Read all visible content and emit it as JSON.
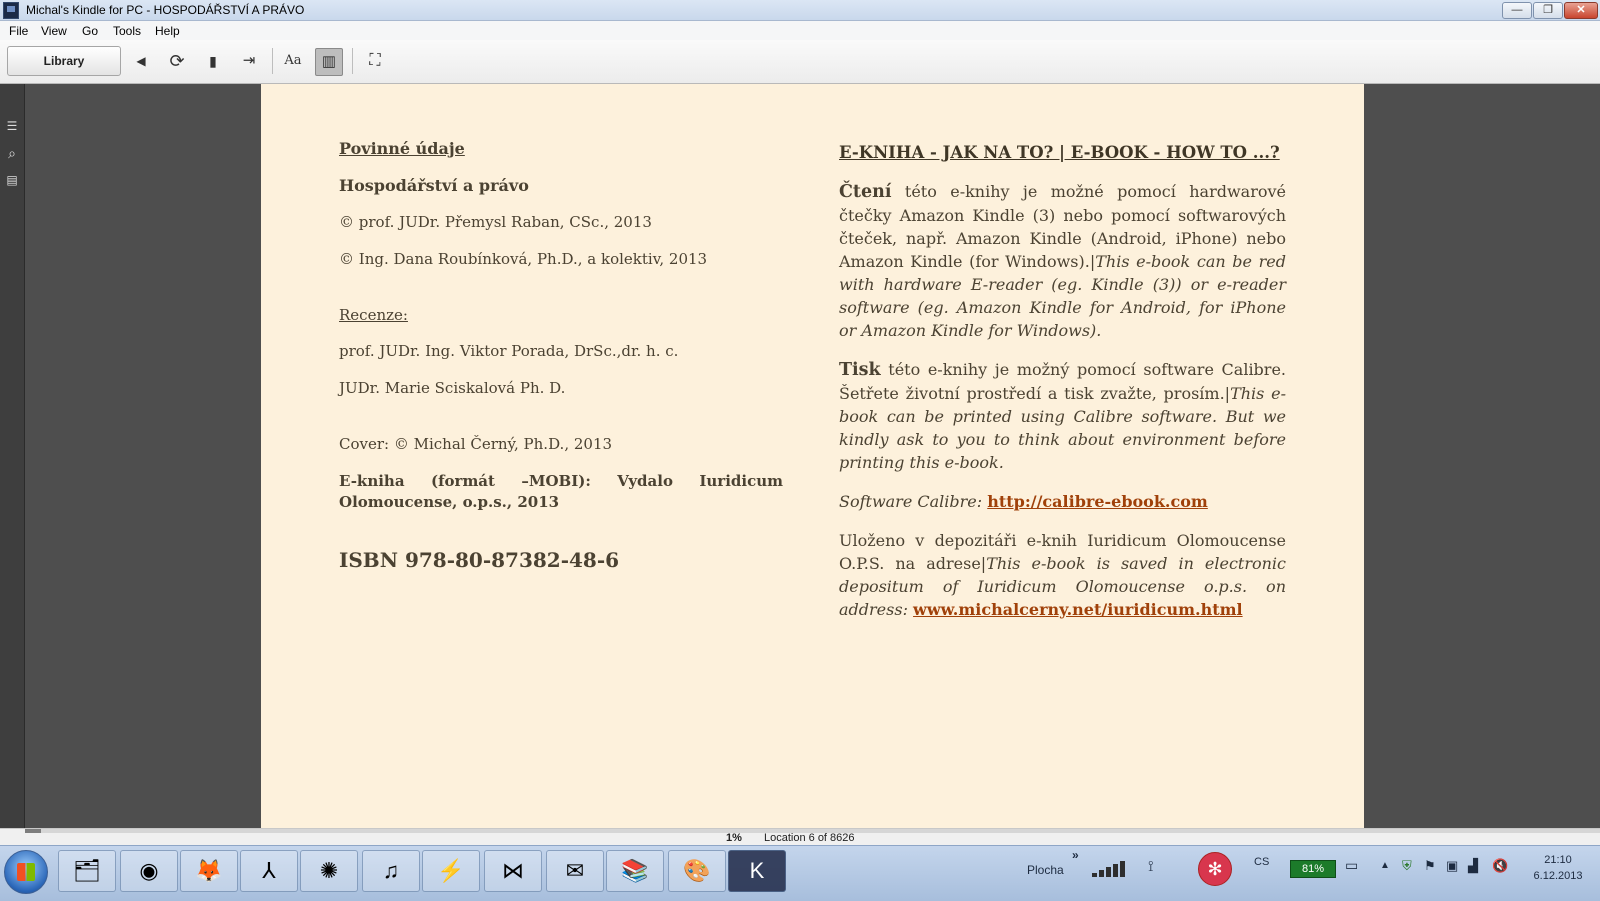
{
  "window": {
    "title": "Michal's Kindle for PC - HOSPODÁŘSTVÍ A PRÁVO",
    "controls": {
      "minimize": "—",
      "maximize": "❐",
      "close": "✕"
    }
  },
  "menu": {
    "file": "File",
    "view": "View",
    "go": "Go",
    "tools": "Tools",
    "help": "Help"
  },
  "toolbar": {
    "library_label": "Library",
    "icons": {
      "back": "◀",
      "sync": "⟳",
      "bookmark": "▮",
      "goto": "⇥",
      "font": "Aa",
      "columns": "▥",
      "fullscreen": "⛶"
    }
  },
  "sidebar": {
    "toc": "☰",
    "search": "⌕",
    "notes": "▤"
  },
  "book": {
    "left": {
      "mandatory_heading": "Povinné údaje",
      "book_title": "Hospodářství a právo",
      "copyright_1": "© prof. JUDr. Přemysl Raban, CSc., 2013",
      "copyright_2": "© Ing. Dana Roubínková, Ph.D., a kolektiv, 2013",
      "reviews_heading": "Recenze:",
      "reviewer_1": "prof. JUDr. Ing. Viktor Porada, DrSc.,dr. h. c.",
      "reviewer_2": "JUDr. Marie Sciskalová Ph. D.",
      "cover": "Cover:  © Michal Černý, Ph.D., 2013",
      "publisher": "E-kniha (formát –MOBI): Vydalo Iuridicum Olomoucense, o.p.s., 2013",
      "isbn": "ISBN 978-80-87382-48-6"
    },
    "right": {
      "heading": "E-KNIHA - JAK NA TO? | E-BOOK - HOW TO ...?",
      "reading_lead": "Čtení",
      "reading_text": " této e-knihy je možné pomocí hardwarové čtečky Amazon Kindle (3) nebo pomocí softwarových čteček, např. Amazon Kindle (Android, iPhone) nebo Amazon Kindle (for Windows).|",
      "reading_en": "This e-book can be red with hardware E-reader (eg. Kindle (3)) or e-reader software (eg. Amazon Kindle for Android, for iPhone or Amazon Kindle for Windows).",
      "print_lead": "Tisk",
      "print_text": " této e-knihy je možný pomocí software Calibre. Šetřete životní prostředí a tisk zvažte, prosím.|",
      "print_en": "This e-book can be printed using Calibre software. But we kindly ask to you to think about environment before printing this e-book.",
      "calibre_label": "Software Calibre: ",
      "calibre_link": "http://calibre-ebook.com",
      "deposit_text": "Uloženo v depozitáři e-knih Iuridicum Olomoucense O.P.S. na adrese|",
      "deposit_en": "This e-book is saved in electronic depositum of Iuridicum Olomoucense o.p.s. on address: ",
      "deposit_link": "www.michalcerny.net/iuridicum.html"
    }
  },
  "status": {
    "percent": "1%",
    "percent_value": 1,
    "location": "Location 6 of 8626"
  },
  "taskbar": {
    "apps": [
      {
        "name": "explorer",
        "glyph": "🗂"
      },
      {
        "name": "chrome",
        "glyph": "◉"
      },
      {
        "name": "firefox",
        "glyph": "🦊"
      },
      {
        "name": "acrobat",
        "glyph": "⅄"
      },
      {
        "name": "app-yellow",
        "glyph": "✺"
      },
      {
        "name": "itunes",
        "glyph": "♫"
      },
      {
        "name": "winamp",
        "glyph": "⚡"
      },
      {
        "name": "visual-studio",
        "glyph": "⋈"
      },
      {
        "name": "thunderbird",
        "glyph": "✉"
      },
      {
        "name": "library-books",
        "glyph": "📚"
      },
      {
        "name": "paint",
        "glyph": "🎨"
      },
      {
        "name": "kindle",
        "glyph": "K"
      }
    ],
    "desktop_label": "Plocha",
    "chevron": "»",
    "language": "CS",
    "battery": "81%",
    "time": "21:10",
    "date": "6.12.2013"
  },
  "colors": {
    "page_bg": "#fdf1dc",
    "link": "#a0410a",
    "reader_bg": "#4e4e4e"
  }
}
